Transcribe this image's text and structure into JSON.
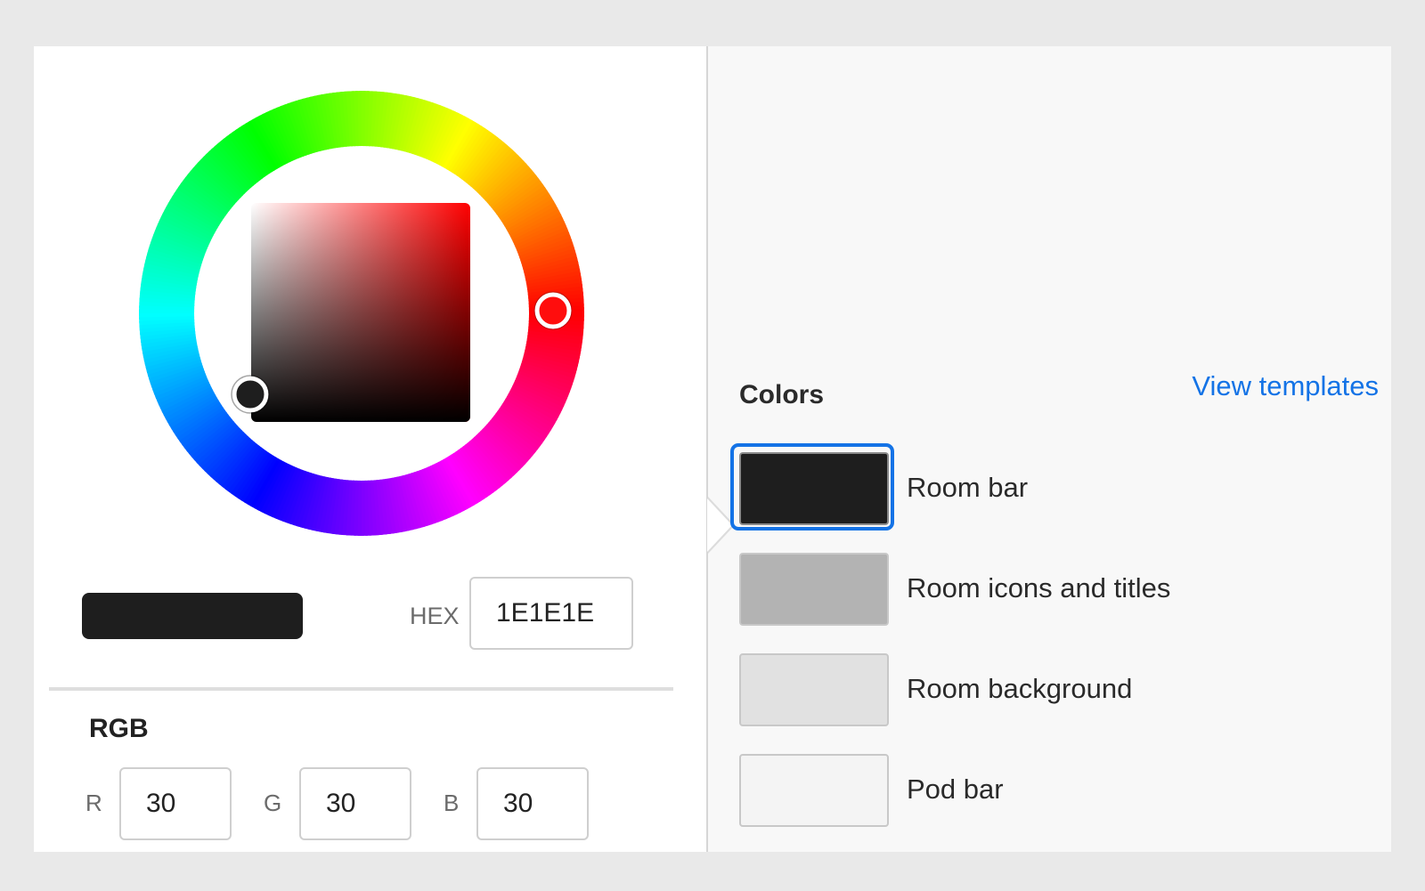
{
  "picker": {
    "current_color": "#1E1E1E",
    "hex_label": "HEX",
    "hex_value": "1E1E1E",
    "hue_color": "#ff0000",
    "rgb_heading": "RGB",
    "r_label": "R",
    "g_label": "G",
    "b_label": "B",
    "r_value": "30",
    "g_value": "30",
    "b_value": "30"
  },
  "colors_panel": {
    "heading": "Colors",
    "view_templates_link": "View templates",
    "items": [
      {
        "label": "Room bar",
        "color": "#1E1E1E",
        "selected": true
      },
      {
        "label": "Room icons and titles",
        "color": "#B3B3B3",
        "selected": false
      },
      {
        "label": "Room background",
        "color": "#E1E1E1",
        "selected": false
      },
      {
        "label": "Pod bar",
        "color": "#F4F4F4",
        "selected": false
      }
    ]
  }
}
